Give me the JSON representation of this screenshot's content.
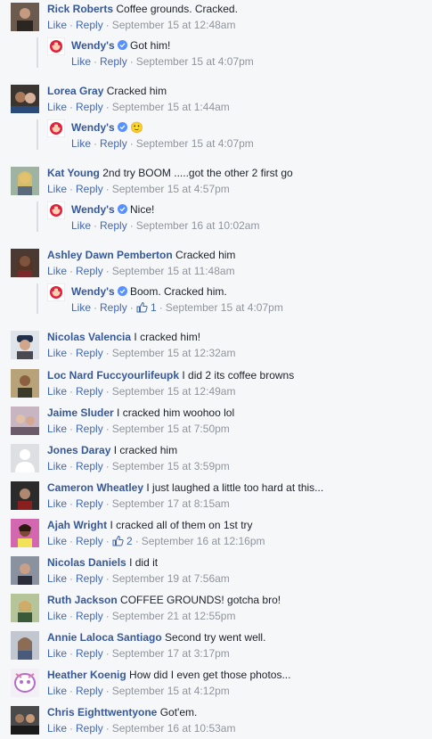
{
  "ui": {
    "like": "Like",
    "reply": "Reply",
    "sep": "·"
  },
  "comments": [
    {
      "author": "Rick Roberts",
      "text": "Coffee grounds. Cracked.",
      "time": "September 15 at 12:48am",
      "reply": {
        "author": "Wendy's",
        "text": "Got him!",
        "time": "September 15 at 4:07pm"
      }
    },
    {
      "author": "Lorea Gray",
      "text": "Cracked him",
      "time": "September 15 at 1:44am",
      "reply": {
        "author": "Wendy's",
        "text": "🙂",
        "time": "September 15 at 4:07pm"
      }
    },
    {
      "author": "Kat Young",
      "text": "2nd try BOOM .....got the other 2 first go",
      "time": "September 15 at 4:57pm",
      "reply": {
        "author": "Wendy's",
        "text": "Nice!",
        "time": "September 16 at 10:02am"
      }
    },
    {
      "author": "Ashley Dawn Pemberton",
      "text": "Cracked him",
      "time": "September 15 at 11:48am",
      "reply": {
        "author": "Wendy's",
        "text": "Boom. Cracked him.",
        "likes": "1",
        "time": "September 15 at 4:07pm"
      }
    },
    {
      "author": "Nicolas Valencia",
      "text": "I cracked him!",
      "time": "September 15 at 12:32am"
    },
    {
      "author": "Loc Nard Fuccyourlifeupk",
      "text": "I did 2 its coffee browns",
      "time": "September 15 at 12:49am"
    },
    {
      "author": "Jaime Sluder",
      "text": "I cracked him woohoo lol",
      "time": "September 15 at 7:50pm"
    },
    {
      "author": "Jones Daray",
      "text": "I cracked him",
      "time": "September 15 at 3:59pm"
    },
    {
      "author": "Cameron Wheatley",
      "text": "I just laughed a little too hard at this...",
      "time": "September 17 at 8:15am"
    },
    {
      "author": "Ajah Wright",
      "text": "I cracked all of them on 1st try",
      "likes": "2",
      "time": "September 16 at 12:16pm"
    },
    {
      "author": "Nicolas Daniels",
      "text": "I did it",
      "time": "September 19 at 7:56am"
    },
    {
      "author": "Ruth Jackson",
      "text": "COFFEE GROUNDS! gotcha bro!",
      "time": "September 21 at 12:55pm"
    },
    {
      "author": "Annie Laloca Santiago",
      "text": "Second try went well.",
      "time": "September 17 at 3:17pm"
    },
    {
      "author": "Heather Koenig",
      "text": "How did I even get those photos...",
      "time": "September 15 at 4:12pm"
    },
    {
      "author": "Chris Eighttwentyone",
      "text": "Got'em.",
      "time": "September 16 at 10:53am"
    }
  ],
  "colors": {
    "author": "#365899",
    "action": "#4267b2",
    "meta": "#90949c",
    "verified": "#5890ff",
    "background": "#f6f7f9"
  },
  "icons": {
    "verified": "verified-badge-icon",
    "thumb": "thumbs-up-icon",
    "wendys_logo": "wendys-logo"
  }
}
